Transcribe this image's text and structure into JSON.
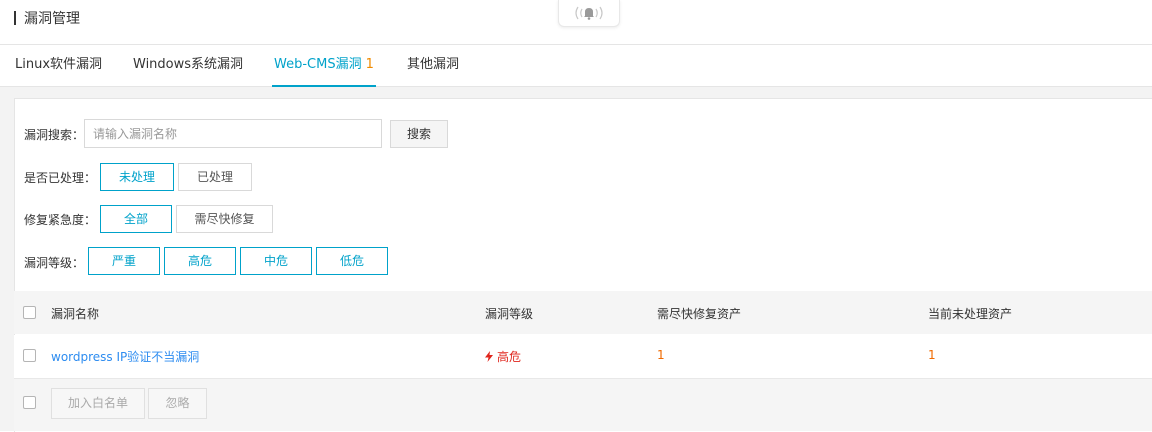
{
  "header": {
    "title": "漏洞管理"
  },
  "tabs": [
    {
      "label": "Linux软件漏洞",
      "count": ""
    },
    {
      "label": "Windows系统漏洞",
      "count": ""
    },
    {
      "label": "Web-CMS漏洞",
      "count": "1"
    },
    {
      "label": "其他漏洞",
      "count": ""
    }
  ],
  "filters": {
    "search_label": "漏洞搜索：",
    "search_placeholder": "请输入漏洞名称",
    "search_button": "搜索",
    "processed_label": "是否已处理：",
    "processed_options": [
      "未处理",
      "已处理"
    ],
    "urgency_label": "修复紧急度：",
    "urgency_options": [
      "全部",
      "需尽快修复"
    ],
    "level_label": "漏洞等级：",
    "level_options": [
      "严重",
      "高危",
      "中危",
      "低危"
    ]
  },
  "table": {
    "columns": [
      "漏洞名称",
      "漏洞等级",
      "需尽快修复资产",
      "当前未处理资产"
    ],
    "rows": [
      {
        "name": "wordpress IP验证不当漏洞",
        "level": "高危",
        "urgent_assets": "1",
        "unprocessed_assets": "1"
      }
    ]
  },
  "actions": {
    "whitelist": "加入白名单",
    "ignore": "忽略"
  },
  "colors": {
    "accent": "#00a2ca",
    "danger": "#e0251c",
    "count": "#f06a00",
    "link": "#2d8cf0"
  },
  "icons": {
    "notification": "bell-icon",
    "level": "lightning-icon"
  }
}
